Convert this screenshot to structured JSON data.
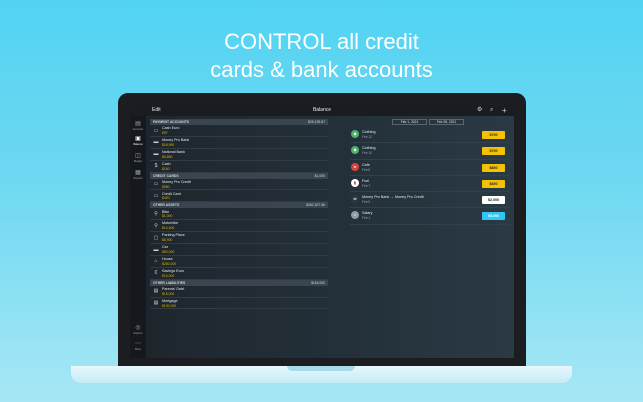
{
  "headline": {
    "line1": "CONTROL all credit",
    "line2": "cards & bank accounts"
  },
  "topbar": {
    "edit_label": "Edit",
    "title": "Balance",
    "icons": [
      "gear-icon",
      "search-icon",
      "plus-icon"
    ]
  },
  "rail": {
    "items": [
      {
        "label": "Accounts",
        "icon": "wallet-icon"
      },
      {
        "label": "Balance",
        "icon": "balance-icon"
      },
      {
        "label": "Budget",
        "icon": "budget-icon"
      },
      {
        "label": "Reports",
        "icon": "reports-icon"
      },
      {
        "label": "Explore",
        "icon": "explore-icon"
      },
      {
        "label": "More",
        "icon": "more-icon"
      }
    ]
  },
  "accounts": {
    "sections": [
      {
        "title": "PAYMENT ACCOUNTS",
        "total": "$25,139.67",
        "items": [
          {
            "name": "Cash Euro",
            "value": "€97",
            "icon": "cash-icon"
          },
          {
            "name": "Money Pro Bank",
            "value": "$18,990",
            "icon": "bank-icon"
          },
          {
            "name": "National Bank",
            "value": "$5,850",
            "icon": "bank-icon"
          },
          {
            "name": "Cash",
            "value": "$150",
            "icon": "dollar-icon"
          }
        ]
      },
      {
        "title": "CREDIT CARDS",
        "total": "$1,000",
        "items": [
          {
            "name": "Money Pro Credit",
            "value": "$580",
            "icon": "card-icon"
          },
          {
            "name": "Credit Card",
            "value": "$420",
            "icon": "card-icon"
          }
        ]
      },
      {
        "title": "OTHER ASSETS",
        "total": "$352,327.56",
        "items": [
          {
            "name": "Bike",
            "value": "$1,000",
            "icon": "bike-icon"
          },
          {
            "name": "Motorbike",
            "value": "$14,400",
            "icon": "motorbike-icon"
          },
          {
            "name": "Parking Place",
            "value": "$8,900",
            "icon": "parking-icon"
          },
          {
            "name": "Car",
            "value": "$50,000",
            "icon": "car-icon"
          },
          {
            "name": "House",
            "value": "$260,000",
            "icon": "house-icon"
          },
          {
            "name": "Savings Euro",
            "value": "€15,000",
            "icon": "savings-icon"
          }
        ]
      },
      {
        "title": "OTHER LIABILITIES",
        "total": "$118,000",
        "items": [
          {
            "name": "Parents' Debt",
            "value": "$18,000",
            "icon": "debt-icon"
          },
          {
            "name": "Mortgage",
            "value": "$100,000",
            "icon": "mortgage-icon"
          }
        ]
      }
    ]
  },
  "period": {
    "from": "Feb 1, 2021",
    "to": "Feb 28, 2021"
  },
  "transactions": [
    {
      "name": "Clothing",
      "date": "Feb 12",
      "amount": "$700",
      "icon": "clothing-icon",
      "icon_color": "#4fb06a",
      "kind": "expense"
    },
    {
      "name": "Clothing",
      "date": "Feb 10",
      "amount": "$700",
      "icon": "clothing-icon",
      "icon_color": "#4fb06a",
      "kind": "expense"
    },
    {
      "name": "Cafe",
      "date": "Feb 8",
      "amount": "$800",
      "icon": "cafe-icon",
      "icon_color": "#d8453a",
      "kind": "expense"
    },
    {
      "name": "Fuel",
      "date": "Feb 7",
      "amount": "$300",
      "icon": "fuel-icon",
      "icon_color": "#ffffff",
      "kind": "expense"
    },
    {
      "name": "Money Pro Bank → Money Pro Credit",
      "date": "Feb 5",
      "amount": "$2,000",
      "icon": "transfer-icon",
      "icon_color": "#2c3540",
      "kind": "transfer"
    },
    {
      "name": "Salary",
      "date": "Feb 1",
      "amount": "$5,000",
      "icon": "salary-icon",
      "icon_color": "#8e9aa4",
      "kind": "income"
    }
  ],
  "colors": {
    "expense": "#f3c200",
    "transfer": "#ffffff",
    "income": "#2ec6f2",
    "value_green": "#d7b400"
  }
}
